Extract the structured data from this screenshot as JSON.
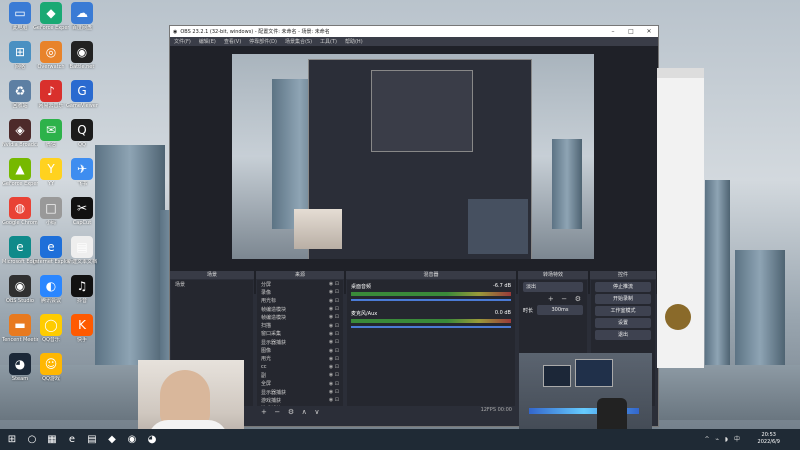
{
  "desktop": {
    "icons": [
      {
        "label": "此电脑",
        "col": 0,
        "row": 0,
        "color": "#3a7bd5",
        "glyph": "▭"
      },
      {
        "label": "GeForce Experience",
        "col": 1,
        "row": 0,
        "color": "#19a974",
        "glyph": "◆"
      },
      {
        "label": "百度网盘",
        "col": 2,
        "row": 0,
        "color": "#3a7bd5",
        "glyph": "☁"
      },
      {
        "label": "网络",
        "col": 0,
        "row": 1,
        "color": "#4a90c2",
        "glyph": "⊞"
      },
      {
        "label": "Overwatch",
        "col": 1,
        "row": 1,
        "color": "#e8832a",
        "glyph": "◎"
      },
      {
        "label": "Battle.net",
        "col": 2,
        "row": 1,
        "color": "#222",
        "glyph": "◉"
      },
      {
        "label": "回收站",
        "col": 0,
        "row": 2,
        "color": "#5d7fa3",
        "glyph": "♻"
      },
      {
        "label": "网易云音乐",
        "col": 1,
        "row": 2,
        "color": "#d9302c",
        "glyph": "♪"
      },
      {
        "label": "GameViewer",
        "col": 2,
        "row": 2,
        "color": "#2a6ad0",
        "glyph": "G"
      },
      {
        "label": "Nvidia Broadcast",
        "col": 0,
        "row": 3,
        "color": "#4d2a2a",
        "glyph": "◈"
      },
      {
        "label": "微信",
        "col": 1,
        "row": 3,
        "color": "#2db24a",
        "glyph": "✉"
      },
      {
        "label": "QQ",
        "col": 2,
        "row": 3,
        "color": "#1b1b1b",
        "glyph": "Q"
      },
      {
        "label": "GeForce Experience",
        "col": 0,
        "row": 4,
        "color": "#76b900",
        "glyph": "▲"
      },
      {
        "label": "YY",
        "col": 1,
        "row": 4,
        "color": "#ffd21f",
        "glyph": "Y"
      },
      {
        "label": "飞书",
        "col": 2,
        "row": 4,
        "color": "#3e8df0",
        "glyph": "✈"
      },
      {
        "label": "Google Chrome",
        "col": 0,
        "row": 5,
        "color": "#e94235",
        "glyph": "◍"
      },
      {
        "label": "小码",
        "col": 1,
        "row": 5,
        "color": "#999",
        "glyph": "□"
      },
      {
        "label": "CapCut",
        "col": 2,
        "row": 5,
        "color": "#111",
        "glyph": "✂"
      },
      {
        "label": "Microsoft Edge",
        "col": 0,
        "row": 6,
        "color": "#0f8a8a",
        "glyph": "e"
      },
      {
        "label": "Internet Explorer",
        "col": 1,
        "row": 6,
        "color": "#1e6fd9",
        "glyph": "e"
      },
      {
        "label": "新建文本文档",
        "col": 2,
        "row": 6,
        "color": "#eee",
        "glyph": "▤"
      },
      {
        "label": "OBS Studio",
        "col": 0,
        "row": 7,
        "color": "#303030",
        "glyph": "◉"
      },
      {
        "label": "腾讯会议",
        "col": 1,
        "row": 7,
        "color": "#2a86ff",
        "glyph": "◐"
      },
      {
        "label": "抖音",
        "col": 2,
        "row": 7,
        "color": "#111",
        "glyph": "♫"
      },
      {
        "label": "Tencent Meeting",
        "col": 0,
        "row": 8,
        "color": "#e87a1f",
        "glyph": "▬"
      },
      {
        "label": "QQ音乐",
        "col": 1,
        "row": 8,
        "color": "#ffcc00",
        "glyph": "◯"
      },
      {
        "label": "快手",
        "col": 2,
        "row": 8,
        "color": "#ff5a00",
        "glyph": "K"
      },
      {
        "label": "Steam",
        "col": 0,
        "row": 9,
        "color": "#1b2838",
        "glyph": "◕"
      },
      {
        "label": "QQ游戏",
        "col": 1,
        "row": 9,
        "color": "#ffb703",
        "glyph": "☺"
      }
    ]
  },
  "taskbar": {
    "items": [
      "⊞",
      "○",
      "▦",
      "e",
      "▤",
      "◆",
      "◉",
      "◕"
    ],
    "tray": "^ ⌁ ◗ 中",
    "time": "20:53",
    "date": "2022/6/9"
  },
  "obs": {
    "title": "OBS 23.2.1 (32-bit, windows) - 配置文件: 未命名 - 场景: 未命名",
    "menu": [
      "文件(F)",
      "编辑(E)",
      "查看(V)",
      "停靠部件(D)",
      "场景集合(S)",
      "工具(T)",
      "帮助(H)"
    ],
    "docks": {
      "scenes": {
        "title": "场景",
        "items": [
          "场景"
        ]
      },
      "sources": {
        "title": "来源",
        "items": [
          "分屏",
          "录像",
          "用光标",
          "帧编造模块",
          "帧编造模块",
          "扫描",
          "窗口采集",
          "显示器捕获",
          "图像",
          "用光",
          "cc",
          "副",
          "全屏",
          "显示器捕获",
          "游戏捕获",
          "游戏捕获 2"
        ]
      },
      "mixer": {
        "title": "混音器",
        "channels": [
          {
            "name": "桌面音频",
            "db": "-6.7 dB"
          },
          {
            "name": "麦克风/Aux",
            "db": "0.0 dB"
          }
        ]
      },
      "transitions": {
        "title": "转场特效",
        "type": "淡出",
        "duration_label": "时长",
        "duration": "300ms"
      },
      "controls": {
        "title": "控件",
        "buttons": [
          "停止推流",
          "开始录制",
          "工作室模式",
          "设置",
          "退出"
        ]
      }
    },
    "status": "12FPS  00:00"
  }
}
